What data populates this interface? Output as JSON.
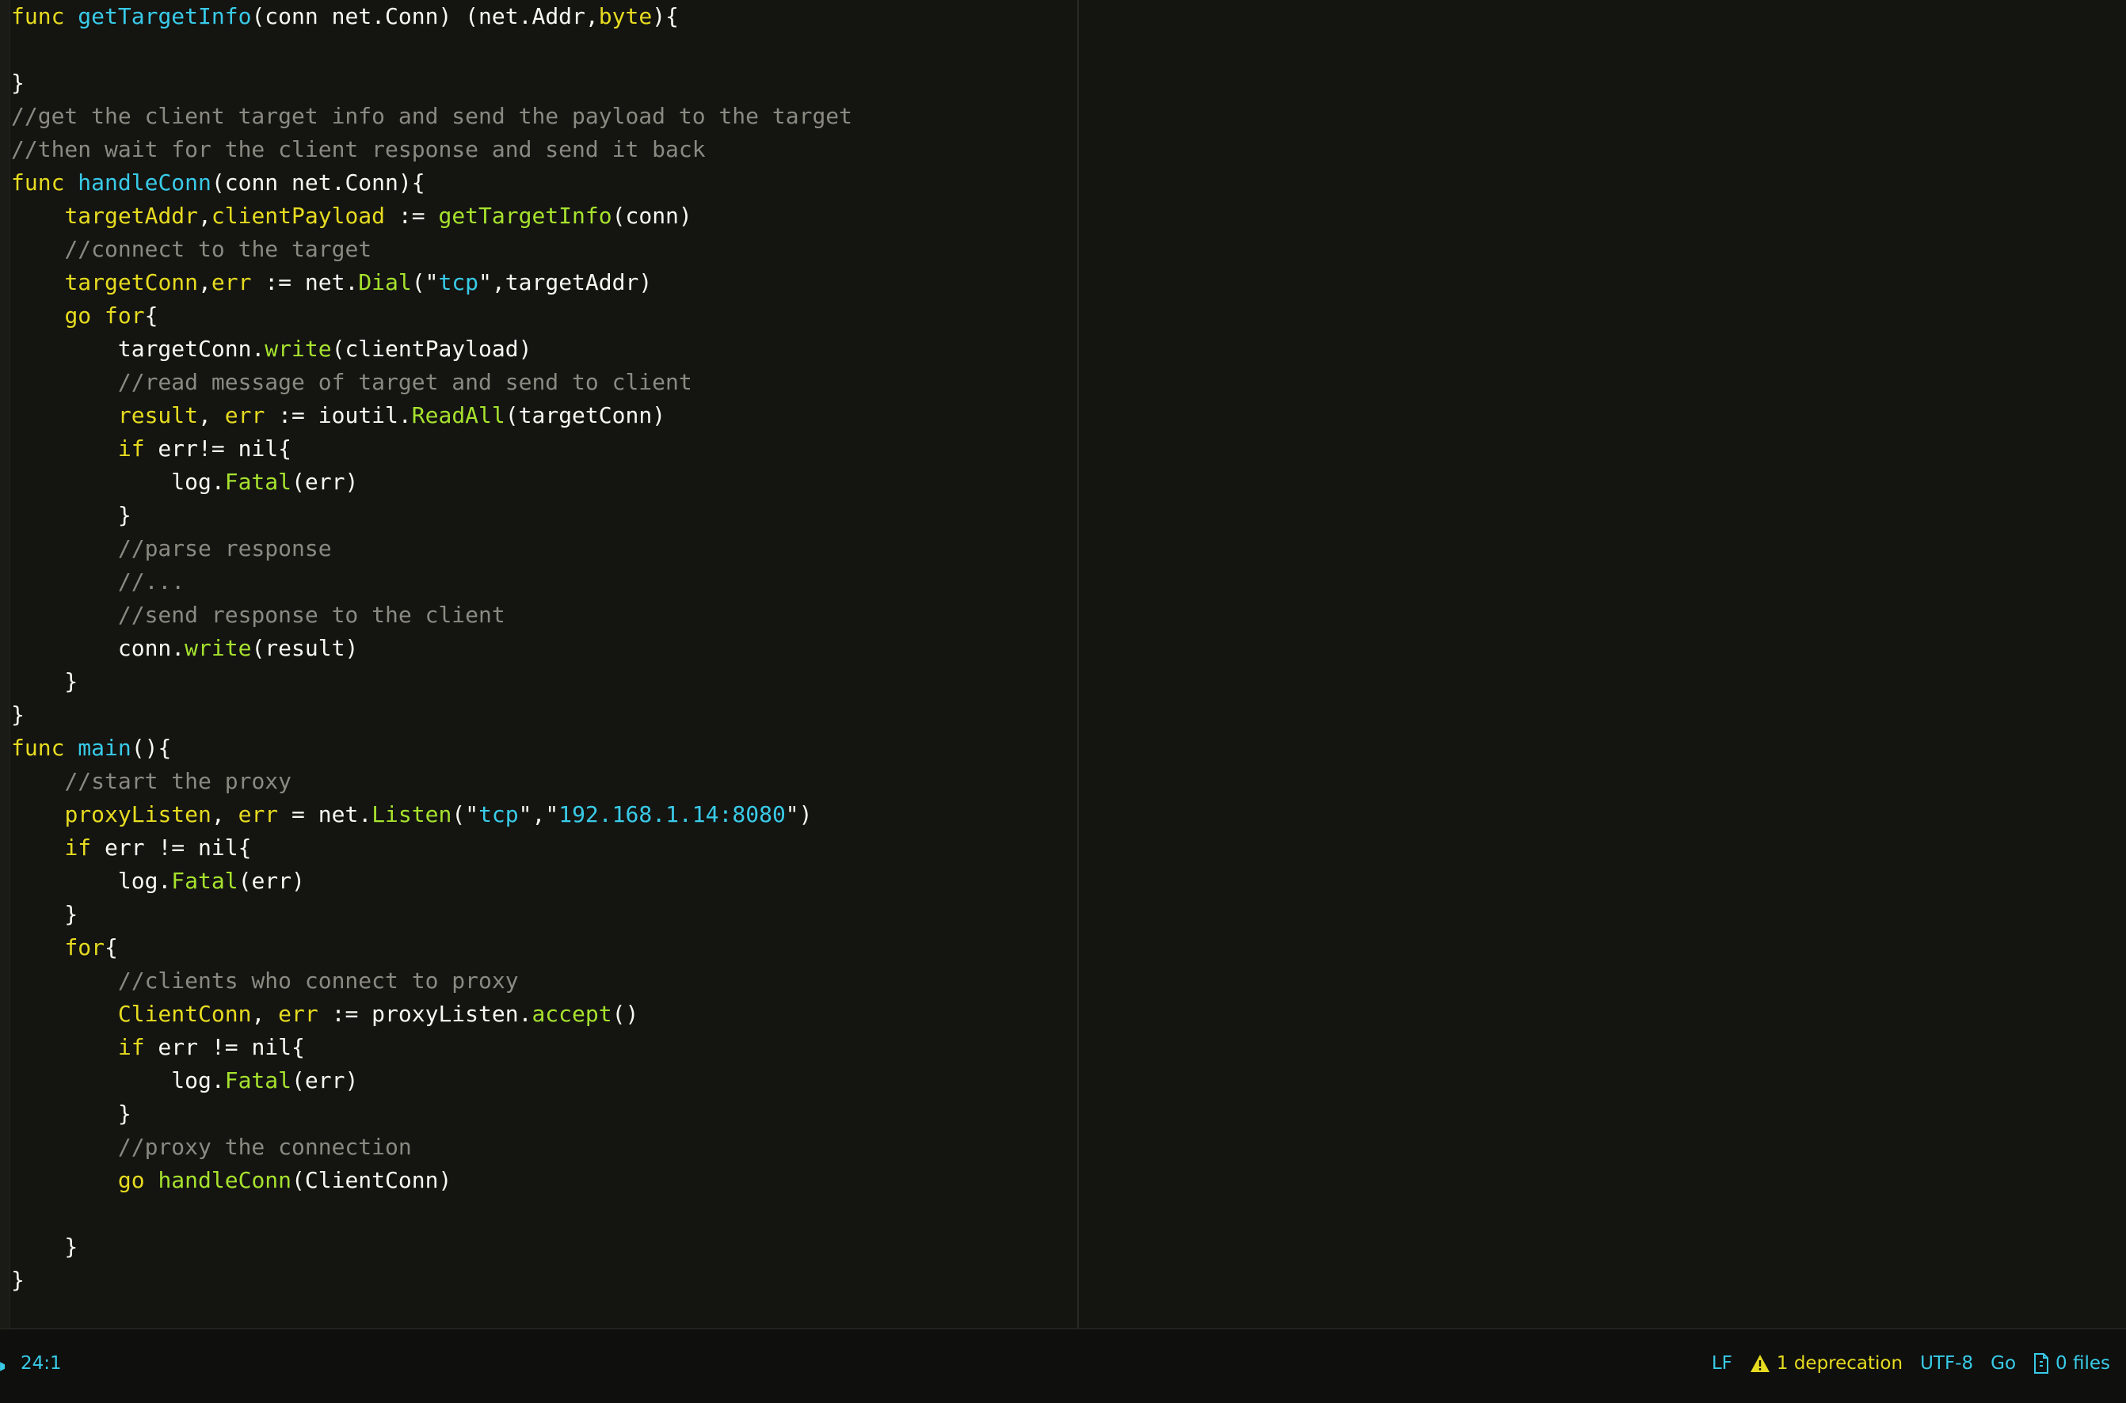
{
  "editor": {
    "lines": [
      [
        {
          "t": "func",
          "c": "k"
        },
        {
          "t": " ",
          "c": ""
        },
        {
          "t": "getTargetInfo",
          "c": "f"
        },
        {
          "t": "(conn net.Conn) (net.Addr,",
          "c": ""
        },
        {
          "t": "byte",
          "c": "t"
        },
        {
          "t": "){",
          "c": ""
        }
      ],
      [],
      [
        {
          "t": "}",
          "c": ""
        }
      ],
      [
        {
          "t": "//get the client target info and send the payload to the target",
          "c": "c"
        }
      ],
      [
        {
          "t": "//then wait for the client response and send it back",
          "c": "c"
        }
      ],
      [
        {
          "t": "func",
          "c": "k"
        },
        {
          "t": " ",
          "c": ""
        },
        {
          "t": "handleConn",
          "c": "f"
        },
        {
          "t": "(conn net.Conn){",
          "c": ""
        }
      ],
      [
        {
          "t": "    ",
          "c": ""
        },
        {
          "t": "targetAddr",
          "c": "v"
        },
        {
          "t": ",",
          "c": ""
        },
        {
          "t": "clientPayload",
          "c": "v"
        },
        {
          "t": " := ",
          "c": ""
        },
        {
          "t": "getTargetInfo",
          "c": "m"
        },
        {
          "t": "(conn)",
          "c": ""
        }
      ],
      [
        {
          "t": "    ",
          "c": ""
        },
        {
          "t": "//connect to the target",
          "c": "c"
        }
      ],
      [
        {
          "t": "    ",
          "c": ""
        },
        {
          "t": "targetConn",
          "c": "v"
        },
        {
          "t": ",",
          "c": ""
        },
        {
          "t": "err",
          "c": "v"
        },
        {
          "t": " := net.",
          "c": ""
        },
        {
          "t": "Dial",
          "c": "m"
        },
        {
          "t": "(\"",
          "c": ""
        },
        {
          "t": "tcp",
          "c": "s"
        },
        {
          "t": "\",targetAddr)",
          "c": ""
        }
      ],
      [
        {
          "t": "    ",
          "c": ""
        },
        {
          "t": "go",
          "c": "k"
        },
        {
          "t": " ",
          "c": ""
        },
        {
          "t": "for",
          "c": "k"
        },
        {
          "t": "{",
          "c": ""
        }
      ],
      [
        {
          "t": "        targetConn.",
          "c": ""
        },
        {
          "t": "write",
          "c": "m"
        },
        {
          "t": "(clientPayload)",
          "c": ""
        }
      ],
      [
        {
          "t": "        ",
          "c": ""
        },
        {
          "t": "//read message of target and send to client",
          "c": "c"
        }
      ],
      [
        {
          "t": "        ",
          "c": ""
        },
        {
          "t": "result",
          "c": "v"
        },
        {
          "t": ", ",
          "c": ""
        },
        {
          "t": "err",
          "c": "v"
        },
        {
          "t": " := ioutil.",
          "c": ""
        },
        {
          "t": "ReadAll",
          "c": "m"
        },
        {
          "t": "(targetConn)",
          "c": ""
        }
      ],
      [
        {
          "t": "        ",
          "c": ""
        },
        {
          "t": "if",
          "c": "k"
        },
        {
          "t": " err!= nil{",
          "c": ""
        }
      ],
      [
        {
          "t": "            log.",
          "c": ""
        },
        {
          "t": "Fatal",
          "c": "m"
        },
        {
          "t": "(err)",
          "c": ""
        }
      ],
      [
        {
          "t": "        }",
          "c": ""
        }
      ],
      [
        {
          "t": "        ",
          "c": ""
        },
        {
          "t": "//parse response",
          "c": "c"
        }
      ],
      [
        {
          "t": "        ",
          "c": ""
        },
        {
          "t": "//...",
          "c": "c"
        }
      ],
      [
        {
          "t": "        ",
          "c": ""
        },
        {
          "t": "//send response to the client",
          "c": "c"
        }
      ],
      [
        {
          "t": "        conn.",
          "c": ""
        },
        {
          "t": "write",
          "c": "m"
        },
        {
          "t": "(result)",
          "c": ""
        }
      ],
      [
        {
          "t": "    }",
          "c": ""
        }
      ],
      [
        {
          "t": "}",
          "c": ""
        }
      ],
      [
        {
          "t": "func",
          "c": "k"
        },
        {
          "t": " ",
          "c": ""
        },
        {
          "t": "main",
          "c": "f"
        },
        {
          "t": "(){",
          "c": ""
        }
      ],
      [
        {
          "t": "    ",
          "c": ""
        },
        {
          "t": "//start the proxy",
          "c": "c"
        }
      ],
      [
        {
          "t": "    ",
          "c": ""
        },
        {
          "t": "proxyListen",
          "c": "v"
        },
        {
          "t": ", ",
          "c": ""
        },
        {
          "t": "err",
          "c": "v"
        },
        {
          "t": " = net.",
          "c": ""
        },
        {
          "t": "Listen",
          "c": "m"
        },
        {
          "t": "(\"",
          "c": ""
        },
        {
          "t": "tcp",
          "c": "s"
        },
        {
          "t": "\",\"",
          "c": ""
        },
        {
          "t": "192.168.1.14:8080",
          "c": "s"
        },
        {
          "t": "\")",
          "c": ""
        }
      ],
      [
        {
          "t": "    ",
          "c": ""
        },
        {
          "t": "if",
          "c": "k"
        },
        {
          "t": " err != nil{",
          "c": ""
        }
      ],
      [
        {
          "t": "        log.",
          "c": ""
        },
        {
          "t": "Fatal",
          "c": "m"
        },
        {
          "t": "(err)",
          "c": ""
        }
      ],
      [
        {
          "t": "    }",
          "c": ""
        }
      ],
      [
        {
          "t": "    ",
          "c": ""
        },
        {
          "t": "for",
          "c": "k"
        },
        {
          "t": "{",
          "c": ""
        }
      ],
      [
        {
          "t": "        ",
          "c": ""
        },
        {
          "t": "//clients who connect to proxy",
          "c": "c"
        }
      ],
      [
        {
          "t": "        ",
          "c": ""
        },
        {
          "t": "ClientConn",
          "c": "v"
        },
        {
          "t": ", ",
          "c": ""
        },
        {
          "t": "err",
          "c": "v"
        },
        {
          "t": " := proxyListen.",
          "c": ""
        },
        {
          "t": "accept",
          "c": "m"
        },
        {
          "t": "()",
          "c": ""
        }
      ],
      [
        {
          "t": "        ",
          "c": ""
        },
        {
          "t": "if",
          "c": "k"
        },
        {
          "t": " err != nil{",
          "c": ""
        }
      ],
      [
        {
          "t": "            log.",
          "c": ""
        },
        {
          "t": "Fatal",
          "c": "m"
        },
        {
          "t": "(err)",
          "c": ""
        }
      ],
      [
        {
          "t": "        }",
          "c": ""
        }
      ],
      [
        {
          "t": "        ",
          "c": ""
        },
        {
          "t": "//proxy the connection",
          "c": "c"
        }
      ],
      [
        {
          "t": "        ",
          "c": ""
        },
        {
          "t": "go",
          "c": "k"
        },
        {
          "t": " ",
          "c": ""
        },
        {
          "t": "handleConn",
          "c": "m"
        },
        {
          "t": "(ClientConn)",
          "c": ""
        }
      ],
      [],
      [
        {
          "t": "    }",
          "c": ""
        }
      ],
      [
        {
          "t": "}",
          "c": ""
        }
      ]
    ]
  },
  "status_bar": {
    "cursor_position": "24:1",
    "line_ending": "LF",
    "deprecation_text": "1 deprecation",
    "encoding": "UTF-8",
    "grammar": "Go",
    "files_text": "0 files"
  },
  "colors": {
    "background": "#141411",
    "keyword": "#e6db20",
    "function": "#39cbe8",
    "method": "#a6e22e",
    "comment": "#8a8a82",
    "text": "#f8f8f2",
    "status_text": "#39cbe8",
    "warning": "#e6db20"
  },
  "icons": {
    "warning": "warning-icon",
    "files": "file-icon"
  }
}
